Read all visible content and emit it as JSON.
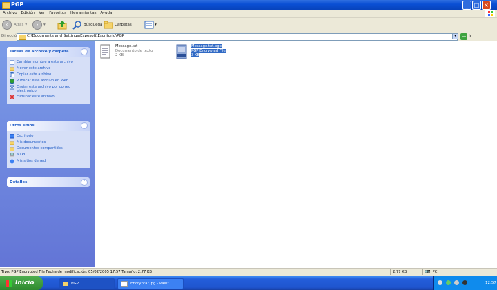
{
  "window": {
    "title": "PGP"
  },
  "menu": [
    "Archivo",
    "Edición",
    "Ver",
    "Favoritos",
    "Herramientas",
    "Ayuda"
  ],
  "toolbar": {
    "back_label": "Atrás",
    "search_label": "Búsqueda",
    "folders_label": "Carpetas"
  },
  "address": {
    "label": "Dirección",
    "path": "C:\\Documents and Settings\\Espesoft\\Escritorio\\PGP",
    "go_label": "Ir"
  },
  "tasks_panel": {
    "title": "Tareas de archivo y carpeta",
    "items": [
      {
        "label": "Cambiar nombre a este archivo",
        "icon": "rename-icon"
      },
      {
        "label": "Mover este archivo",
        "icon": "move-icon"
      },
      {
        "label": "Copiar este archivo",
        "icon": "copy-icon"
      },
      {
        "label": "Publicar este archivo en Web",
        "icon": "web-publish-icon"
      },
      {
        "label": "Enviar este archivo por correo electrónico",
        "icon": "email-icon"
      },
      {
        "label": "Eliminar este archivo",
        "icon": "delete-icon"
      }
    ]
  },
  "places_panel": {
    "title": "Otros sitios",
    "items": [
      {
        "label": "Escritorio",
        "icon": "desktop-icon"
      },
      {
        "label": "Mis documentos",
        "icon": "documents-icon"
      },
      {
        "label": "Documentos compartidos",
        "icon": "shared-folder-icon"
      },
      {
        "label": "Mi PC",
        "icon": "computer-icon"
      },
      {
        "label": "Mis sitios de red",
        "icon": "network-icon"
      }
    ]
  },
  "details_panel": {
    "title": "Detalles"
  },
  "files": [
    {
      "name": "Message.txt",
      "type": "Documento de texto",
      "size": "2 KB",
      "selected": false
    },
    {
      "name": "Message.txt.pgp",
      "type": "PGP Encrypted File",
      "size": "3 KB",
      "selected": true
    }
  ],
  "status": {
    "info": "Tipo: PGP Encrypted File Fecha de modificación: 05/02/2005 17:57 Tamaño: 2,77 KB",
    "size": "2,77 KB",
    "location": "Mi PC"
  },
  "taskbar": {
    "start_label": "Inicio",
    "tasks": [
      {
        "label": "PGP",
        "active": true
      },
      {
        "label": "Encryptar.jpg - Paint",
        "active": false
      }
    ],
    "clock": "12:57"
  },
  "colors": {
    "accent": "#0a4fd4",
    "link": "#215dc6",
    "selection": "#316ac5"
  }
}
